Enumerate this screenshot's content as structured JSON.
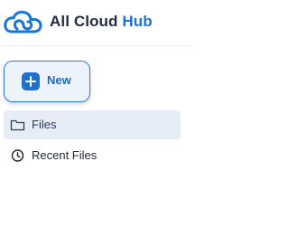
{
  "brand": {
    "name_prefix": "All Cloud",
    "name_suffix": "Hub",
    "logo_icon": "cloud-logo-icon",
    "colors": {
      "primary": "#1a73d9",
      "text": "#1f2a44"
    }
  },
  "actions": {
    "new_label": "New",
    "new_icon": "plus-icon"
  },
  "nav": {
    "items": [
      {
        "label": "Files",
        "icon": "folder-icon",
        "active": true
      },
      {
        "label": "Recent Files",
        "icon": "clock-icon",
        "active": false
      }
    ]
  }
}
